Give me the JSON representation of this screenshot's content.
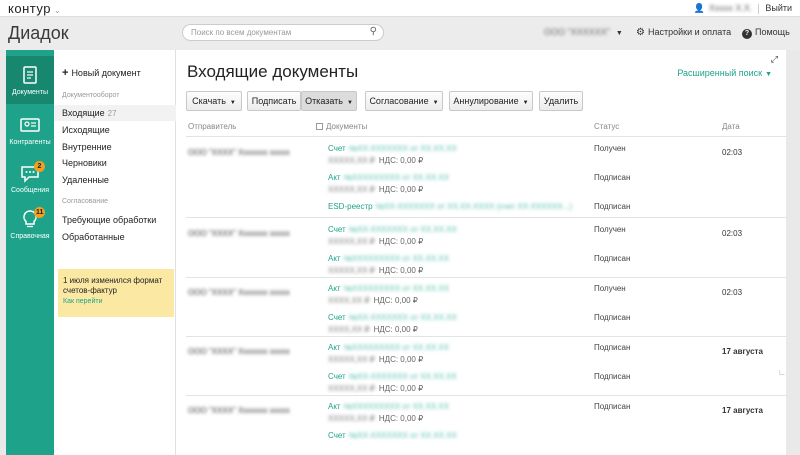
{
  "topbar": {
    "logo": "контур",
    "user_name": "Ххххх Х.Х.",
    "logout": "Выйти"
  },
  "header": {
    "app_title": "Диадок",
    "search_placeholder": "Поиск по всем документам",
    "org_name": "ООО \"ХХХХХХ\"",
    "settings_label": "Настройки и оплата",
    "help_label": "Помощь"
  },
  "rail": [
    {
      "label": "Документы",
      "icon": "documents-icon",
      "active": true
    },
    {
      "label": "Контрагенты",
      "icon": "contacts-icon",
      "active": false
    },
    {
      "label": "Сообщения",
      "icon": "messages-icon",
      "badge": "2",
      "active": false
    },
    {
      "label": "Справочная",
      "icon": "lightbulb-icon",
      "badge": "11",
      "active": false
    }
  ],
  "sidebar": {
    "new_document": "Новый документ",
    "section_docflow": "Документооборот",
    "incoming": "Входящие",
    "incoming_count": "27",
    "outgoing": "Исходящие",
    "internal": "Внутренние",
    "drafts": "Черновики",
    "deleted": "Удаленные",
    "section_approval": "Согласование",
    "needs_processing": "Требующие обработки",
    "processed": "Обработанные",
    "notice_text": "1 июля изменился формат счетов-фактур",
    "notice_link": "Как перейти"
  },
  "main": {
    "title": "Входящие документы",
    "advanced_search": "Расширенный поиск",
    "toolbar": {
      "download": "Скачать",
      "sign": "Подписать",
      "reject": "Отказать",
      "approval": "Согласование",
      "annul": "Аннулирование",
      "delete": "Удалить"
    },
    "columns": {
      "sender": "Отправитель",
      "documents": "Документы",
      "status": "Статус",
      "date": "Дата"
    },
    "groups": [
      {
        "sender": "ООО \"ХХХХ\" Ххххххх ххххх",
        "date": "02:03",
        "docs": [
          {
            "type": "Счет",
            "number": "№ХХ-ХХХХХХХ от ХХ.ХХ.ХХ",
            "amount": "ХХХХХ,ХХ ₽",
            "vat": "НДС: 0,00 ₽",
            "status": "Получен"
          },
          {
            "type": "Акт",
            "number": "№ХХХХХХХХХ от ХХ.ХХ.ХХ",
            "amount": "ХХХХХ,ХХ ₽",
            "vat": "НДС: 0,00 ₽",
            "status": "Подписан"
          },
          {
            "type": "ESD-реестр",
            "number": "№ХХ-ХХХХХХХ от ХХ.ХХ.ХХХХ (счет ХХ-ХХХХХХ...)",
            "amount": "",
            "vat": "",
            "status": "Подписан"
          }
        ]
      },
      {
        "sender": "ООО \"ХХХХ\" Ххххххх ххххх",
        "date": "02:03",
        "docs": [
          {
            "type": "Счет",
            "number": "№ХХ-ХХХХХХХ от ХХ.ХХ.ХХ",
            "amount": "ХХХХХ,ХХ ₽",
            "vat": "НДС: 0,00 ₽",
            "status": "Получен"
          },
          {
            "type": "Акт",
            "number": "№ХХХХХХХХХ от ХХ.ХХ.ХХ",
            "amount": "ХХХХХ,ХХ ₽",
            "vat": "НДС: 0,00 ₽",
            "status": "Подписан"
          }
        ]
      },
      {
        "sender": "ООО \"ХХХХ\" Ххххххх ххххх",
        "date": "02:03",
        "docs": [
          {
            "type": "Акт",
            "number": "№ХХХХХХХХХ от ХХ.ХХ.ХХ",
            "amount": "ХХХХ,ХХ ₽",
            "vat": "НДС: 0,00 ₽",
            "status": "Получен"
          },
          {
            "type": "Счет",
            "number": "№ХХ-ХХХХХХХ от ХХ.ХХ.ХХ",
            "amount": "ХХХХ,ХХ ₽",
            "vat": "НДС: 0,00 ₽",
            "status": "Подписан"
          }
        ]
      },
      {
        "sender": "ООО \"ХХХХ\" Ххххххх ххххх",
        "date": "17 августа",
        "docs": [
          {
            "type": "Акт",
            "number": "№ХХХХХХХХХ от ХХ.ХХ.ХХ",
            "amount": "ХХХХХ,ХХ ₽",
            "vat": "НДС: 0,00 ₽",
            "status": "Подписан"
          },
          {
            "type": "Счет",
            "number": "№ХХ-ХХХХХХХ от ХХ.ХХ.ХХ",
            "amount": "ХХХХХ,ХХ ₽",
            "vat": "НДС: 0,00 ₽",
            "status": "Подписан"
          }
        ]
      },
      {
        "sender": "ООО \"ХХХХ\" Ххххххх ххххх",
        "date": "17 августа",
        "docs": [
          {
            "type": "Акт",
            "number": "№ХХХХХХХХХ от ХХ.ХХ.ХХ",
            "amount": "ХХХХХ,ХХ ₽",
            "vat": "НДС: 0,00 ₽",
            "status": "Подписан"
          },
          {
            "type": "Счет",
            "number": "№ХХ-ХХХХХХХ от ХХ.ХХ.ХХ",
            "amount": "",
            "vat": "",
            "status": ""
          }
        ]
      }
    ]
  },
  "colors": {
    "accent": "#1ea38a",
    "rail_active": "#17876f",
    "badge": "#f0a020",
    "notice_bg": "#fbe9a3"
  }
}
